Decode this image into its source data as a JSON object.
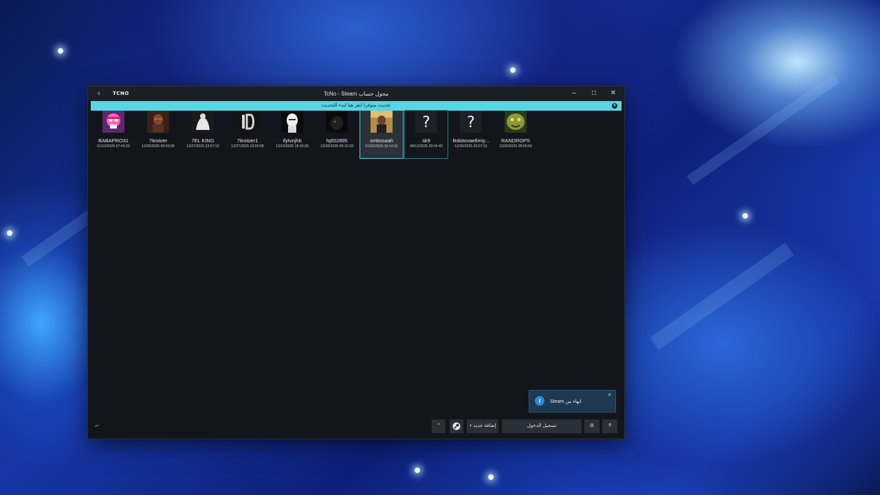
{
  "window": {
    "logo": "TCNO",
    "title": "TcNo - Steam محول حساب",
    "back_icon": "chevron-left-icon",
    "controls": [
      "minimize",
      "maximize",
      "close"
    ]
  },
  "update_banner": {
    "message": "تحديث متوفرا انقر هنا لبدء التحديث"
  },
  "accounts": [
    {
      "name": "BABAPRO31",
      "last_login": "01/13/2026 07:46:20",
      "avatar": "pink-skull-avatar"
    },
    {
      "name": "7lestoer",
      "last_login": "12/28/2025 00:03:39",
      "avatar": "armored-warrior-avatar"
    },
    {
      "name": "7EL KING",
      "last_login": "12/27/2025 23:57:16",
      "avatar": "hand-sketch-avatar"
    },
    {
      "name": "7lestoer1",
      "last_login": "12/27/2025 23:55:58",
      "avatar": "id-logo-avatar"
    },
    {
      "name": "ifytvnjhb",
      "last_login": "12/13/2025 18:39:30",
      "avatar": "bald-man-avatar"
    },
    {
      "name": "fq652895",
      "last_login": "12/28/2025 00:15:33",
      "avatar": "dark-figure-avatar"
    },
    {
      "name": "smbosaah",
      "last_login": "01/03/2026 19:14:32",
      "avatar": "person-photo-avatar",
      "selected": true
    },
    {
      "name": "sk9",
      "last_login": "08/12/2025 20:04:40",
      "avatar": "question-mark-avatar"
    },
    {
      "name": "fedotovaefimiy...",
      "last_login": "12/20/2025 20:07:31",
      "avatar": "question-mark-avatar"
    },
    {
      "name": "RANDROPS",
      "last_login": "12/20/2025 08:05:04",
      "avatar": "green-creature-avatar"
    }
  ],
  "toast": {
    "text": "Steam انهاء من"
  },
  "bottom": {
    "filter_label": "تم",
    "add_new_label": "إضافة جديد",
    "login_label": "تسجيل الدخول"
  },
  "colors": {
    "window_bg": "#12161c",
    "titlebar_bg": "#1b2027",
    "banner_bg": "#59d6e3",
    "selected_outline": "#52cfe0",
    "button_bg": "#2a3037"
  }
}
